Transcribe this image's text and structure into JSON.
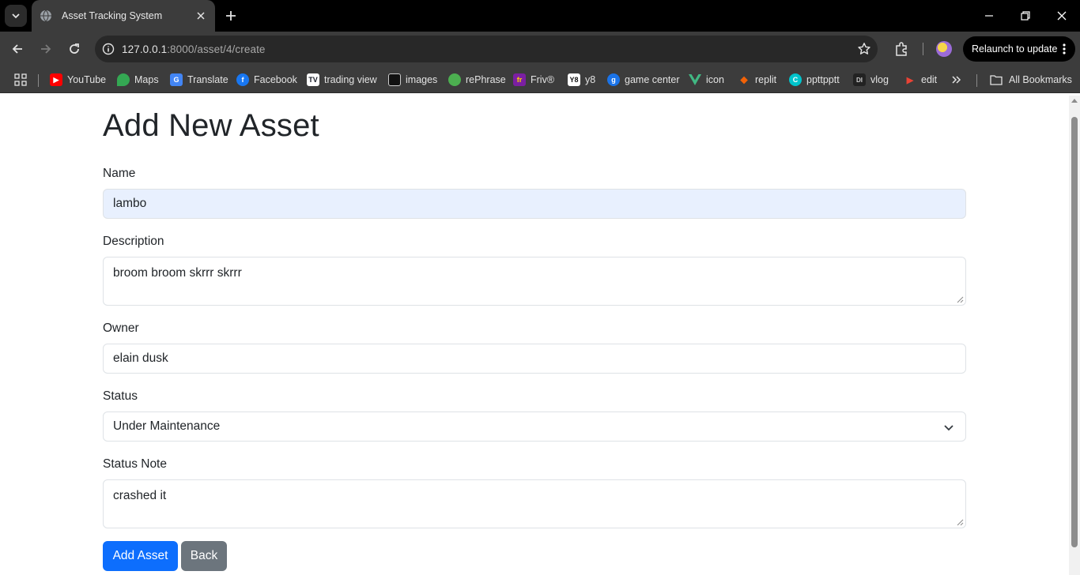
{
  "browser": {
    "tab_title": "Asset Tracking System",
    "url_host": "127.0.0.1",
    "url_rest": ":8000/asset/4/create",
    "relaunch_label": "Relaunch to update",
    "bookmarks": [
      {
        "label": "YouTube",
        "icon": "youtube-icon",
        "color": "#ff0000"
      },
      {
        "label": "Maps",
        "icon": "maps-icon",
        "color": "#34a853"
      },
      {
        "label": "Translate",
        "icon": "translate-icon",
        "color": "#4285f4"
      },
      {
        "label": "Facebook",
        "icon": "facebook-icon",
        "color": "#1877f2"
      },
      {
        "label": "trading view",
        "icon": "tradingview-icon",
        "color": "#131722"
      },
      {
        "label": "images",
        "icon": "images-icon",
        "color": "#222222"
      },
      {
        "label": "rePhrase",
        "icon": "rephrase-icon",
        "color": "#4caf50"
      },
      {
        "label": "Friv®",
        "icon": "friv-icon",
        "color": "#7b1fa2"
      },
      {
        "label": "y8",
        "icon": "y8-icon",
        "color": "#ffffff"
      },
      {
        "label": "game center",
        "icon": "game-center-icon",
        "color": "#1a73e8"
      },
      {
        "label": "icon",
        "icon": "vue-icon",
        "color": "#41b883"
      },
      {
        "label": "replit",
        "icon": "replit-icon",
        "color": "#f26207"
      },
      {
        "label": "ppttpptt",
        "icon": "canva-icon",
        "color": "#00c4cc"
      },
      {
        "label": "vlog",
        "icon": "vlog-icon",
        "color": "#444444"
      },
      {
        "label": "edit",
        "icon": "edit-icon",
        "color": "#ea4335"
      }
    ],
    "all_bookmarks_label": "All Bookmarks"
  },
  "page": {
    "title": "Add New Asset",
    "form": {
      "name_label": "Name",
      "name_value": "lambo",
      "description_label": "Description",
      "description_value": "broom broom skrrr skrrr",
      "owner_label": "Owner",
      "owner_value": "elain dusk",
      "status_label": "Status",
      "status_value": "Under Maintenance",
      "status_note_label": "Status Note",
      "status_note_value": "crashed it"
    },
    "buttons": {
      "add_label": "Add Asset",
      "back_label": "Back"
    }
  },
  "colors": {
    "primary": "#0d6efd",
    "secondary": "#6c757d",
    "autofill": "#e8f0fe"
  }
}
